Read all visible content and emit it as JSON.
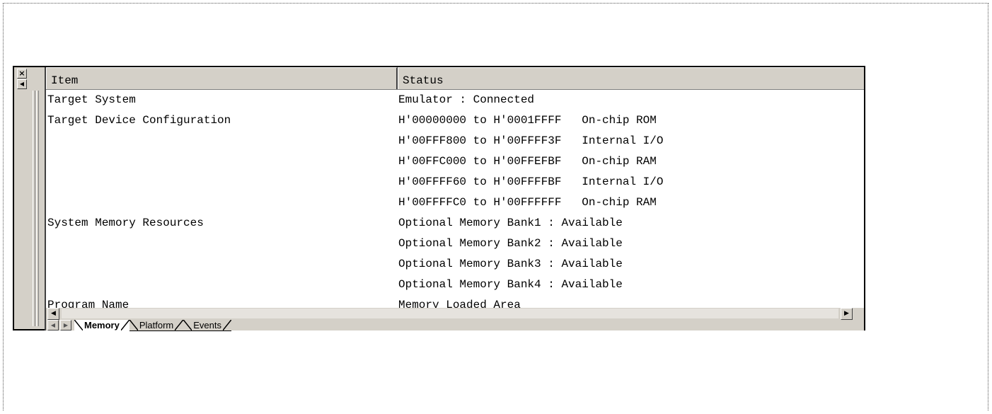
{
  "window": {
    "close_glyph": "×",
    "collapse_glyph": "◀"
  },
  "table": {
    "columns": [
      "Item",
      "Status"
    ],
    "rows": [
      {
        "item": "Target System",
        "status": "Emulator : Connected"
      },
      {
        "item": "Target Device Configuration",
        "status": "H'00000000 to H'0001FFFF   On-chip ROM"
      },
      {
        "item": "",
        "status": "H'00FFF800 to H'00FFFF3F   Internal I/O"
      },
      {
        "item": "",
        "status": "H'00FFC000 to H'00FFEFBF   On-chip RAM"
      },
      {
        "item": "",
        "status": "H'00FFFF60 to H'00FFFFBF   Internal I/O"
      },
      {
        "item": "",
        "status": "H'00FFFFC0 to H'00FFFFFF   On-chip RAM"
      },
      {
        "item": "System Memory Resources",
        "status": "Optional Memory Bank1 : Available"
      },
      {
        "item": "",
        "status": "Optional Memory Bank2 : Available"
      },
      {
        "item": "",
        "status": "Optional Memory Bank3 : Available"
      },
      {
        "item": "",
        "status": "Optional Memory Bank4 : Available"
      },
      {
        "item": "Program Name",
        "status": "Memory Loaded Area"
      }
    ]
  },
  "scrollbar": {
    "left_glyph": "◀",
    "right_glyph": "▶"
  },
  "tabs": {
    "prev_glyph": "◀",
    "next_glyph": "▶",
    "items": [
      "Memory",
      "Platform",
      "Events"
    ],
    "active": "Memory"
  }
}
